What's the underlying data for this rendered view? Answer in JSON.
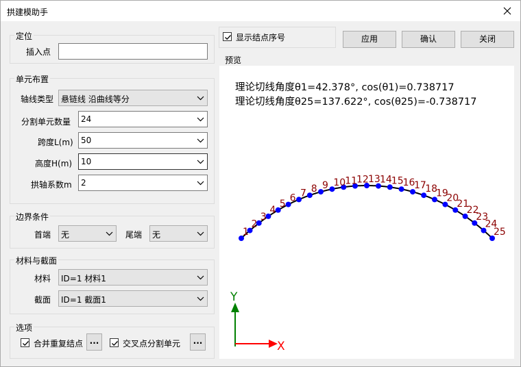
{
  "window": {
    "title": "拱建模助手",
    "close_icon": "close-icon"
  },
  "location": {
    "group_label": "定位",
    "insert_label": "插入点",
    "insert_value": ""
  },
  "layout": {
    "group_label": "单元布置",
    "axis_type_label": "轴线类型",
    "axis_type_value": "悬链线 沿曲线等分",
    "seg_count_label": "分割单元数量",
    "seg_count_value": "24",
    "span_label": "跨度L(m)",
    "span_value": "50",
    "height_label": "高度H(m)",
    "height_value": "10",
    "coef_label": "拱轴系数m",
    "coef_value": "2"
  },
  "boundary": {
    "group_label": "边界条件",
    "head_label": "首端",
    "head_value": "无",
    "tail_label": "尾端",
    "tail_value": "无"
  },
  "material": {
    "group_label": "材料与截面",
    "mat_label": "材料",
    "mat_value": "ID=1  材料1",
    "sec_label": "截面",
    "sec_value": "ID=1  截面1"
  },
  "options": {
    "group_label": "选项",
    "merge_label": "合并重复结点",
    "merge_checked": true,
    "split_label": "交叉点分割单元",
    "split_checked": true,
    "dots_label": "..."
  },
  "top": {
    "show_numbers_label": "显示结点序号",
    "show_numbers_checked": true,
    "apply_label": "应用",
    "ok_label": "确认",
    "close_label": "关闭"
  },
  "preview": {
    "group_label": "预览",
    "line1": "理论切线角度θ1=42.378°, cos(θ1)=0.738717",
    "line2": "理论切线角度θ25=137.622°, cos(θ25)=-0.738717",
    "node_labels": [
      "1",
      "2",
      "3",
      "4",
      "5",
      "6",
      "7",
      "8",
      "9",
      "10",
      "11",
      "12",
      "13",
      "14",
      "15",
      "16",
      "17",
      "18",
      "19",
      "20",
      "21",
      "22",
      "23",
      "24",
      "25"
    ],
    "axis_x": "X",
    "axis_y": "Y",
    "colors": {
      "node": "#0000ff",
      "curve": "#000000",
      "label": "#8b0000",
      "x_axis": "#ff0000",
      "y_axis": "#008000"
    }
  }
}
